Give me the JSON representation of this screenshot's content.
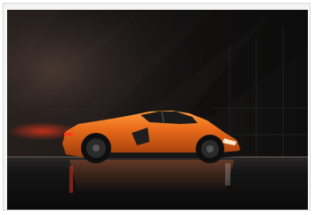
{
  "image": {
    "subject": "orange supercar",
    "colors": {
      "car_body": "#e86a1a",
      "background": "#121212",
      "tail_light": "#ff3a1a",
      "floor_reflection": "#b0532a"
    }
  }
}
